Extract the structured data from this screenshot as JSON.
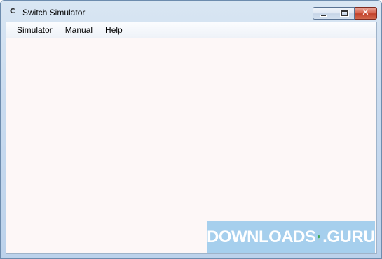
{
  "window": {
    "title": "Switch Simulator",
    "app_icon_char": "C",
    "caption_buttons": {
      "minimize": "minimize-icon",
      "maximize": "maximize-icon",
      "close": "close-icon"
    }
  },
  "menu": {
    "items": [
      {
        "label": "Simulator"
      },
      {
        "label": "Manual"
      },
      {
        "label": "Help"
      }
    ]
  },
  "watermark": {
    "left": "DOWNLOADS",
    "right": ".GURU",
    "logo_icon": "download-arrow-icon"
  },
  "colors": {
    "client_bg": "#fdf7f7",
    "watermark_bg": "#96c8eb",
    "logo_yellow": "#f7c51e",
    "logo_green": "#3aa84b"
  }
}
